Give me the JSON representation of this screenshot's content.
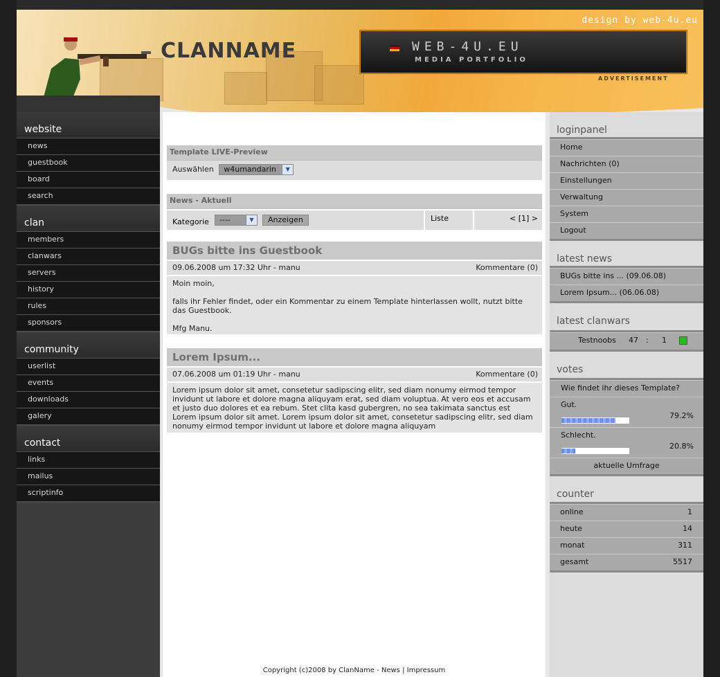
{
  "header": {
    "brand": "CLANNAME",
    "design_by": "design by web-4u.eu",
    "ad_url": "WEB-4U.EU",
    "ad_sub": "MEDIA PORTFOLIO",
    "ad_label": "ADVERTISEMENT"
  },
  "left": {
    "sections": [
      {
        "title": "website",
        "items": [
          "news",
          "guestbook",
          "board",
          "search"
        ]
      },
      {
        "title": "clan",
        "items": [
          "members",
          "clanwars",
          "servers",
          "history",
          "rules",
          "sponsors"
        ]
      },
      {
        "title": "community",
        "items": [
          "userlist",
          "events",
          "downloads",
          "galery"
        ]
      },
      {
        "title": "contact",
        "items": [
          "links",
          "mailus",
          "scriptinfo"
        ]
      }
    ]
  },
  "preview": {
    "title": "Template LIVE-Preview",
    "label": "Auswählen",
    "selected": "w4umandarin"
  },
  "news_filter": {
    "title": "News - Aktuell",
    "label": "Kategorie",
    "selected": "----",
    "button": "Anzeigen",
    "list_label": "Liste",
    "pagination": "< [1] >"
  },
  "news": [
    {
      "title": "BUGs bitte ins Guestbook",
      "meta": "09.06.2008 um 17:32 Uhr - manu",
      "comments": "Kommentare (0)",
      "body": [
        "Moin moin,",
        "falls ihr Fehler findet, oder ein Kommentar zu einem Template hinterlassen wollt, nutzt bitte das Guestbook.",
        "Mfg Manu."
      ]
    },
    {
      "title": "Lorem Ipsum...",
      "meta": "07.06.2008 um 01:19 Uhr - manu",
      "comments": "Kommentare (0)",
      "body": [
        "Lorem ipsum dolor sit amet, consetetur sadipscing elitr, sed diam nonumy eirmod tempor invidunt ut labore et dolore magna aliquyam erat, sed diam voluptua. At vero eos et accusam et justo duo dolores et ea rebum. Stet clita kasd gubergren, no sea takimata sanctus est Lorem ipsum dolor sit amet. Lorem ipsum dolor sit amet, consetetur sadipscing elitr, sed diam nonumy eirmod tempor invidunt ut labore et dolore magna aliquyam"
      ]
    }
  ],
  "footer": {
    "copyright": "Copyright (c)2008 by ClanName - News",
    "sep": "|",
    "impressum": "Impressum"
  },
  "right": {
    "loginpanel": {
      "title": "loginpanel",
      "items": [
        "Home",
        "Nachrichten (0)",
        "Einstellungen",
        "Verwaltung",
        "System",
        "Logout"
      ]
    },
    "latest_news": {
      "title": "latest news",
      "items": [
        "BUGs bitte ins ... (09.06.08)",
        "Lorem Ipsum... (06.06.08)"
      ]
    },
    "latest_clanwars": {
      "title": "latest clanwars",
      "opponent": "Testnoobs",
      "score_own": "47",
      "sep": ":",
      "score_opp": "1",
      "result_color": "#22c01c"
    },
    "votes": {
      "title": "votes",
      "question": "Wie findet ihr dieses Template?",
      "options": [
        {
          "label": "Gut.",
          "percent_text": "79.2%",
          "percent": 79.2
        },
        {
          "label": "Schlecht.",
          "percent_text": "20.8%",
          "percent": 20.8
        }
      ],
      "link": "aktuelle Umfrage"
    },
    "counter": {
      "title": "counter",
      "rows": [
        {
          "label": "online",
          "value": "1"
        },
        {
          "label": "heute",
          "value": "14"
        },
        {
          "label": "monat",
          "value": "311"
        },
        {
          "label": "gesamt",
          "value": "5517"
        }
      ]
    }
  }
}
